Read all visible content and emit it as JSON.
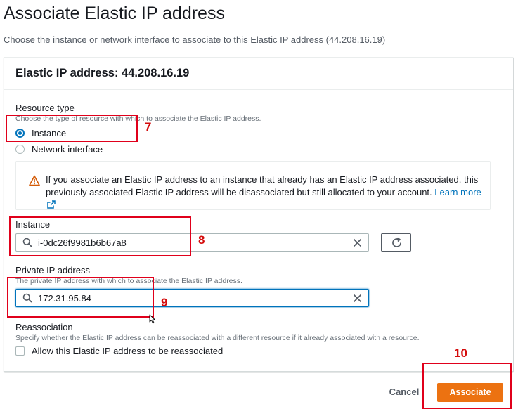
{
  "page": {
    "title": "Associate Elastic IP address",
    "subtitle": "Choose the instance or network interface to associate to this Elastic IP address (44.208.16.19)"
  },
  "card": {
    "header": "Elastic IP address: 44.208.16.19"
  },
  "resource_type": {
    "label": "Resource type",
    "description": "Choose the type of resource with which to associate the Elastic IP address.",
    "options": [
      {
        "label": "Instance",
        "selected": true
      },
      {
        "label": "Network interface",
        "selected": false
      }
    ]
  },
  "alert": {
    "icon": "warning-icon",
    "text": "If you associate an Elastic IP address to an instance that already has an Elastic IP address associated, this previously associated Elastic IP address will be disassociated but still allocated to your account.",
    "link": "Learn more",
    "link_icon": "external-link-icon"
  },
  "instance": {
    "label": "Instance",
    "value": "i-0dc26f9981b6b67a8"
  },
  "private_ip": {
    "label": "Private IP address",
    "description": "The private IP address with which to associate the Elastic IP address.",
    "value": "172.31.95.84"
  },
  "reassociation": {
    "label": "Reassociation",
    "description": "Specify whether the Elastic IP address can be reassociated with a different resource if it already associated with a resource.",
    "checkbox_label": "Allow this Elastic IP address to be reassociated",
    "checked": false
  },
  "footer": {
    "cancel_label": "Cancel",
    "associate_label": "Associate"
  },
  "annotations": [
    "7",
    "8",
    "9",
    "10"
  ],
  "colors": {
    "accent": "#0073bb",
    "primary_button": "#ec7211",
    "annotation": "#e0001b"
  }
}
